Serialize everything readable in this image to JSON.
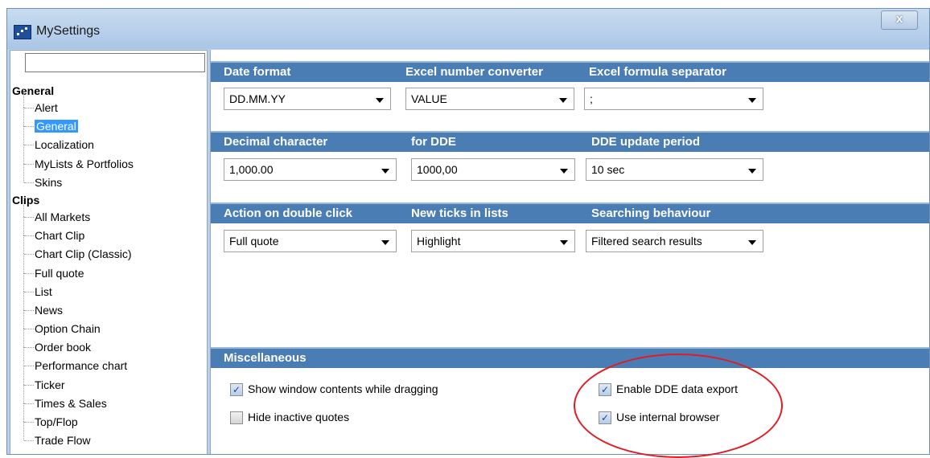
{
  "window": {
    "title": "MySettings",
    "close_label": "x"
  },
  "sidebar": {
    "search": {
      "value": "",
      "placeholder": ""
    },
    "groups": [
      {
        "label": "General",
        "items": [
          "Alert",
          "General",
          "Localization",
          "MyLists & Portfolios",
          "Skins"
        ]
      },
      {
        "label": "Clips",
        "items": [
          "All Markets",
          "Chart Clip",
          "Chart Clip (Classic)",
          "Full quote",
          "List",
          "News",
          "Option Chain",
          "Order book",
          "Performance chart",
          "Ticker",
          "Times & Sales",
          "Top/Flop",
          "Trade Flow"
        ]
      }
    ],
    "selected_item": "General"
  },
  "settings": {
    "row1": {
      "headers": [
        "Date format",
        "Excel number converter",
        "Excel formula separator"
      ],
      "values": [
        "DD.MM.YY",
        "VALUE",
        ";"
      ]
    },
    "row2": {
      "headers": [
        "Decimal character",
        "for DDE",
        "DDE update period"
      ],
      "values": [
        "1,000.00",
        "1000,00",
        "10 sec"
      ]
    },
    "row3": {
      "headers": [
        "Action on double click",
        "New ticks in lists",
        "Searching behaviour"
      ],
      "values": [
        "Full quote",
        "Highlight",
        "Filtered search results"
      ]
    },
    "misc": {
      "header": "Miscellaneous",
      "checkboxes": [
        {
          "label": "Show window contents while dragging",
          "checked": true
        },
        {
          "label": "Hide inactive quotes",
          "checked": false
        },
        {
          "label": "Enable DDE data export",
          "checked": true
        },
        {
          "label": "Use internal browser",
          "checked": true
        }
      ]
    }
  },
  "colors": {
    "section_header": "#4a7db4",
    "selection": "#3399ff",
    "annotation": "#e01c24"
  }
}
